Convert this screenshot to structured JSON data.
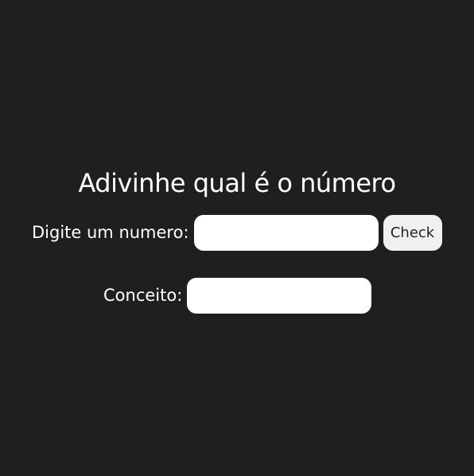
{
  "page": {
    "title": "Adivinhe qual é o número"
  },
  "guess": {
    "label": "Digite um numero:",
    "value": "",
    "placeholder": "",
    "button_label": "Check"
  },
  "concept": {
    "label": "Conceito:",
    "value": ""
  },
  "colors": {
    "background": "#1f1f1f",
    "text": "#ffffff",
    "field": "#ffffff",
    "button": "#f0f0f0"
  }
}
